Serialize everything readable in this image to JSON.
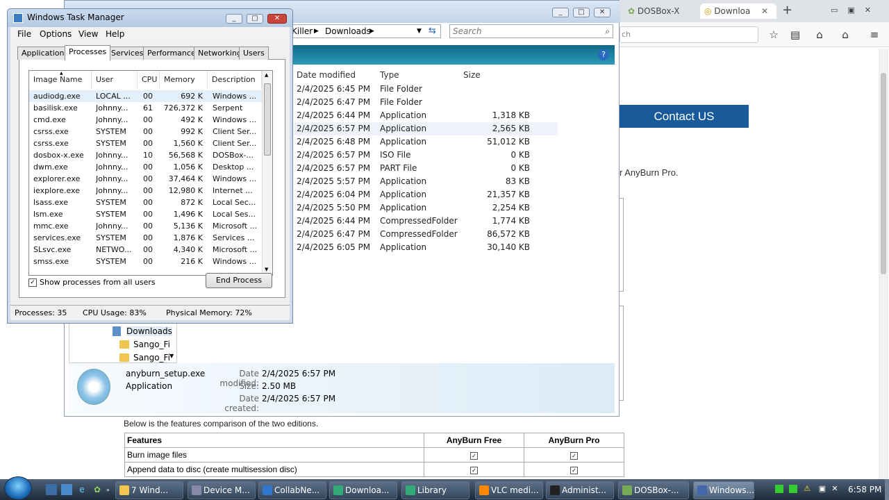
{
  "browser": {
    "tabs": [
      {
        "label": "DOSBox-X"
      },
      {
        "label": "Downloa"
      }
    ],
    "address_placeholder": "ch",
    "contact_button": "Contact US",
    "anyburn_fragment": "r AnyBurn Pro.",
    "comparison_intro": "Below is the features comparison of the two editions.",
    "table": {
      "headers": [
        "Features",
        "AnyBurn Free",
        "AnyBurn Pro"
      ],
      "rows": [
        [
          "Burn image files"
        ],
        [
          "Append data to disc (create multisession disc)"
        ]
      ]
    },
    "icons": {
      "star": "star-icon",
      "reading": "reading-list-icon",
      "home": "home-icon",
      "menu": "menu-icon",
      "add": "new-tab-icon"
    }
  },
  "explorer": {
    "breadcrumb": [
      "Killer",
      "Downloads"
    ],
    "search_placeholder": "Search",
    "columns": [
      "Date modified",
      "Type",
      "Size"
    ],
    "rows": [
      {
        "date": "2/4/2025 6:45 PM",
        "type": "File Folder",
        "size": ""
      },
      {
        "date": "2/4/2025 6:47 PM",
        "type": "File Folder",
        "size": ""
      },
      {
        "date": "2/4/2025 6:44 PM",
        "type": "Application",
        "size": "1,318 KB"
      },
      {
        "date": "2/4/2025 6:57 PM",
        "type": "Application",
        "size": "2,565 KB"
      },
      {
        "date": "2/4/2025 6:48 PM",
        "type": "Application",
        "size": "51,012 KB"
      },
      {
        "date": "2/4/2025 6:57 PM",
        "type": "ISO File",
        "size": "0 KB"
      },
      {
        "date": "2/4/2025 6:57 PM",
        "type": "PART File",
        "size": "0 KB"
      },
      {
        "date": "2/4/2025 5:57 PM",
        "type": "Application",
        "size": "83 KB"
      },
      {
        "date": "2/4/2025 6:04 PM",
        "type": "Application",
        "size": "21,357 KB"
      },
      {
        "date": "2/4/2025 5:50 PM",
        "type": "Application",
        "size": "2,254 KB"
      },
      {
        "date": "2/4/2025 6:44 PM",
        "type": "CompressedFolder",
        "size": "1,774 KB"
      },
      {
        "date": "2/4/2025 6:47 PM",
        "type": "CompressedFolder",
        "size": "86,572 KB"
      },
      {
        "date": "2/4/2025 6:05 PM",
        "type": "Application",
        "size": "30,140 KB"
      }
    ],
    "nav": [
      "Downloads",
      "Sango_Fi",
      "Sango_Fi"
    ],
    "details": {
      "name": "anyburn_setup.exe",
      "kind": "Application",
      "modified_label": "Date modified:",
      "modified": "2/4/2025 6:57 PM",
      "size_label": "Size:",
      "size": "2.50 MB",
      "created_label": "Date created:",
      "created": "2/4/2025 6:57 PM"
    }
  },
  "taskmgr": {
    "title": "Windows Task Manager",
    "menu": [
      "File",
      "Options",
      "View",
      "Help"
    ],
    "tabs": [
      "Applications",
      "Processes",
      "Services",
      "Performance",
      "Networking",
      "Users"
    ],
    "columns": [
      "Image Name",
      "User Name",
      "CPU",
      "Memory (...",
      "Description"
    ],
    "processes": [
      [
        "audiodg.exe",
        "LOCAL ...",
        "00",
        "692 K",
        "Windows ..."
      ],
      [
        "basilisk.exe",
        "Johnny...",
        "61",
        "726,372 K",
        "Serpent"
      ],
      [
        "cmd.exe",
        "Johnny...",
        "00",
        "492 K",
        "Windows ..."
      ],
      [
        "csrss.exe",
        "SYSTEM",
        "00",
        "992 K",
        "Client Ser..."
      ],
      [
        "csrss.exe",
        "SYSTEM",
        "00",
        "1,560 K",
        "Client Ser..."
      ],
      [
        "dosbox-x.exe",
        "Johnny...",
        "10",
        "56,568 K",
        "DOSBox-..."
      ],
      [
        "dwm.exe",
        "Johnny...",
        "00",
        "1,056 K",
        "Desktop ..."
      ],
      [
        "explorer.exe",
        "Johnny...",
        "00",
        "37,464 K",
        "Windows ..."
      ],
      [
        "iexplore.exe",
        "Johnny...",
        "00",
        "12,980 K",
        "Internet ..."
      ],
      [
        "lsass.exe",
        "SYSTEM",
        "00",
        "872 K",
        "Local Sec..."
      ],
      [
        "lsm.exe",
        "SYSTEM",
        "00",
        "1,496 K",
        "Local Ses..."
      ],
      [
        "mmc.exe",
        "Johnny...",
        "00",
        "5,136 K",
        "Microsoft ..."
      ],
      [
        "services.exe",
        "SYSTEM",
        "00",
        "1,876 K",
        "Services ..."
      ],
      [
        "SLsvc.exe",
        "NETWO...",
        "00",
        "4,340 K",
        "Microsoft ..."
      ],
      [
        "smss.exe",
        "SYSTEM",
        "00",
        "216 K",
        "Windows ..."
      ]
    ],
    "show_all_label": "Show processes from all users",
    "end_process": "End Process",
    "status": {
      "processes": "Processes: 35",
      "cpu": "CPU Usage: 83%",
      "memory": "Physical Memory: 72%"
    }
  },
  "taskbar": {
    "buttons": [
      "7 Wind...",
      "Device M...",
      "CollabNe...",
      "Downloa...",
      "Library",
      "VLC medi...",
      "Administ...",
      "DOSBox-...",
      "Windows..."
    ],
    "clock": "6:58 PM"
  }
}
